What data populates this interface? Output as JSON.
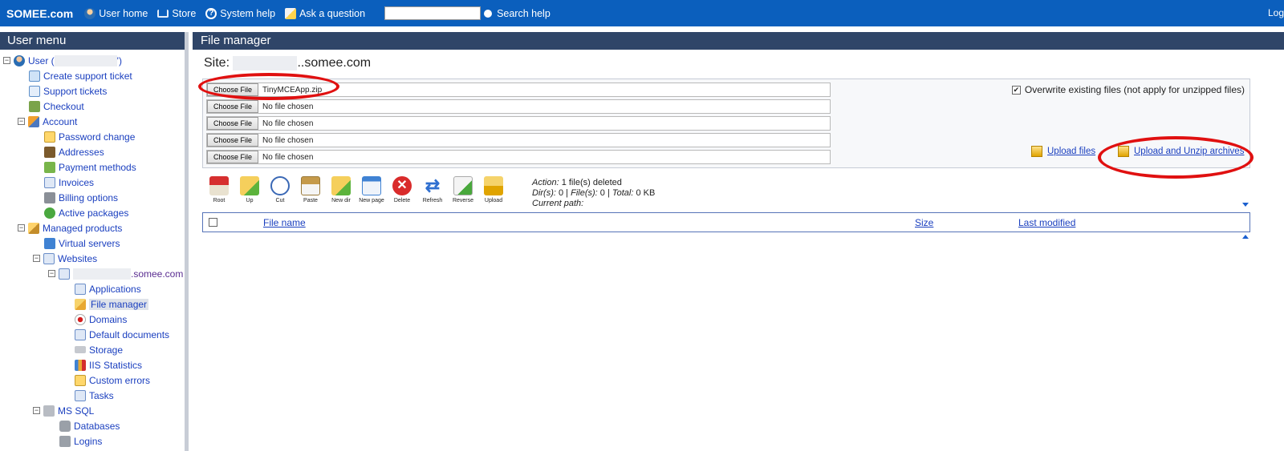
{
  "topbar": {
    "brand": "SOMEE.com",
    "nav": [
      "User home",
      "Store",
      "System help",
      "Ask a question"
    ],
    "search_label": "Search help",
    "right_label": "Log"
  },
  "sidebar": {
    "title": "User menu",
    "user_label": "User (",
    "user_label_end": "')",
    "items": {
      "create_ticket": "Create support ticket",
      "support_tickets": "Support tickets",
      "checkout": "Checkout",
      "account": "Account",
      "password_change": "Password change",
      "addresses": "Addresses",
      "payment_methods": "Payment methods",
      "invoices": "Invoices",
      "billing_options": "Billing options",
      "active_packages": "Active packages",
      "managed_products": "Managed products",
      "virtual_servers": "Virtual servers",
      "websites": "Websites",
      "site_suffix": ".somee.com",
      "applications": "Applications",
      "file_manager": "File manager",
      "domains": "Domains",
      "default_documents": "Default documents",
      "storage": "Storage",
      "iis_statistics": "IIS Statistics",
      "custom_errors": "Custom errors",
      "tasks": "Tasks",
      "ms_sql": "MS SQL",
      "databases": "Databases",
      "logins": "Logins"
    }
  },
  "main": {
    "title": "File manager",
    "site_label": "Site:",
    "site_suffix": "..somee.com",
    "upload": {
      "choose_label": "Choose File",
      "files": [
        "TinyMCEApp.zip",
        "No file chosen",
        "No file chosen",
        "No file chosen",
        "No file chosen"
      ],
      "overwrite_label": "Overwrite existing files (not apply for unzipped files)",
      "overwrite_checked": true,
      "upload_files": "Upload files",
      "upload_unzip": "Upload and Unzip archives"
    },
    "toolbar": [
      "Root",
      "Up",
      "Cut",
      "Paste",
      "New dir",
      "New page",
      "Delete",
      "Refresh",
      "Reverse",
      "Upload"
    ],
    "status": {
      "action_label": "Action:",
      "action_value": "1 file(s) deleted",
      "dirs_label": "Dir(s):",
      "dirs_value": "0",
      "files_label": "File(s):",
      "files_value": "0",
      "total_label": "Total:",
      "total_value": "0 KB",
      "path_label": "Current path:"
    },
    "grid": {
      "columns": [
        "File name",
        "Size",
        "Last modified"
      ]
    }
  },
  "colors": {
    "topbar": "#0b5fbd",
    "header": "#2f4568",
    "link": "#1a3fbf",
    "annotation": "#e01010"
  }
}
